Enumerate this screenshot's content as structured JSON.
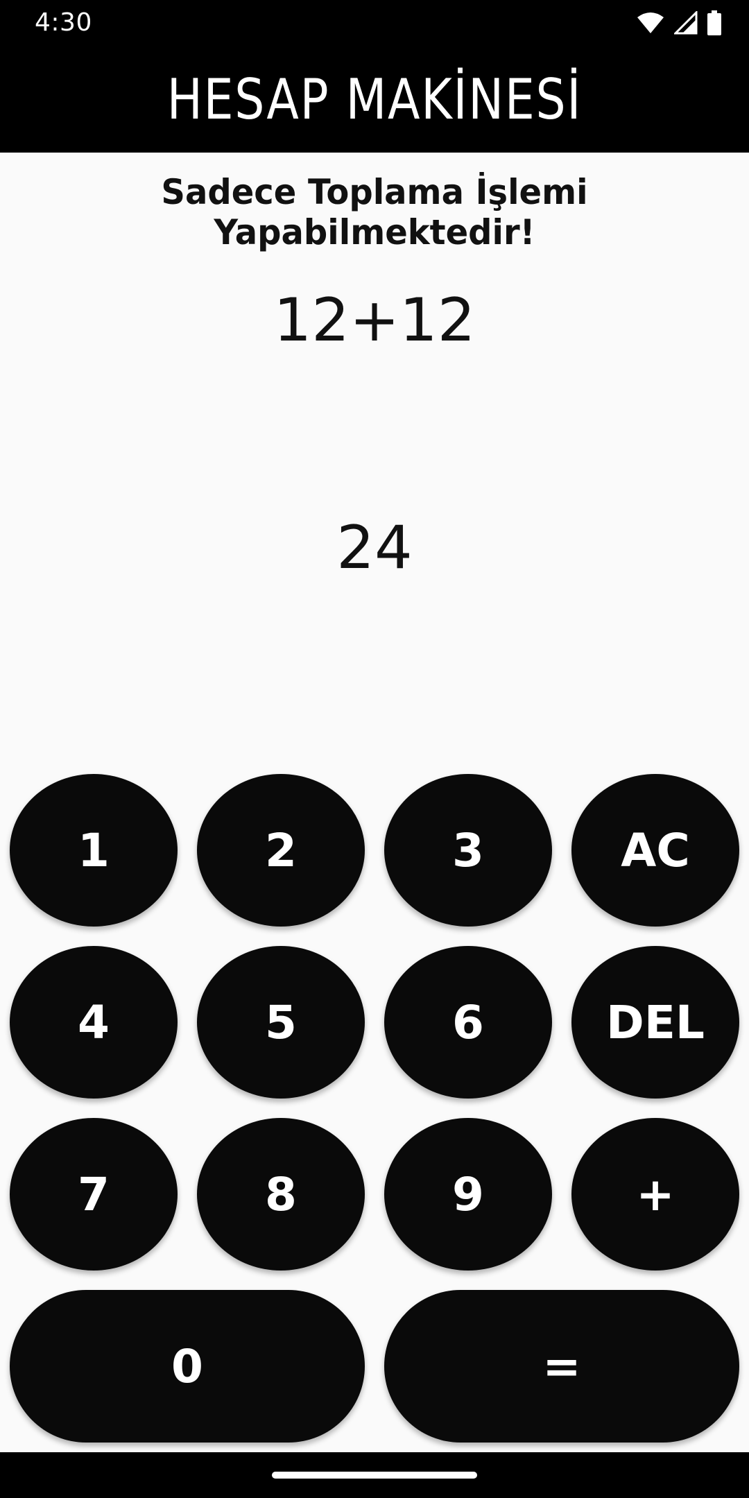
{
  "status_bar": {
    "time": "4:30",
    "icons": [
      "wifi-icon",
      "cell-signal-icon",
      "battery-icon"
    ]
  },
  "app_bar": {
    "title": "HESAP MAKİNESİ"
  },
  "subtitle": "Sadece Toplama İşlemi Yapabilmektedir!",
  "display": {
    "expression": "12+12",
    "result": "24"
  },
  "keypad": {
    "k1": "1",
    "k2": "2",
    "k3": "3",
    "ac": "AC",
    "k4": "4",
    "k5": "5",
    "k6": "6",
    "del": "DEL",
    "k7": "7",
    "k8": "8",
    "k9": "9",
    "plus": "+",
    "k0": "0",
    "equals": "="
  },
  "colors": {
    "app_bar_bg": "#000000",
    "key_bg": "#0a0a0a",
    "page_bg": "#fafafa"
  }
}
